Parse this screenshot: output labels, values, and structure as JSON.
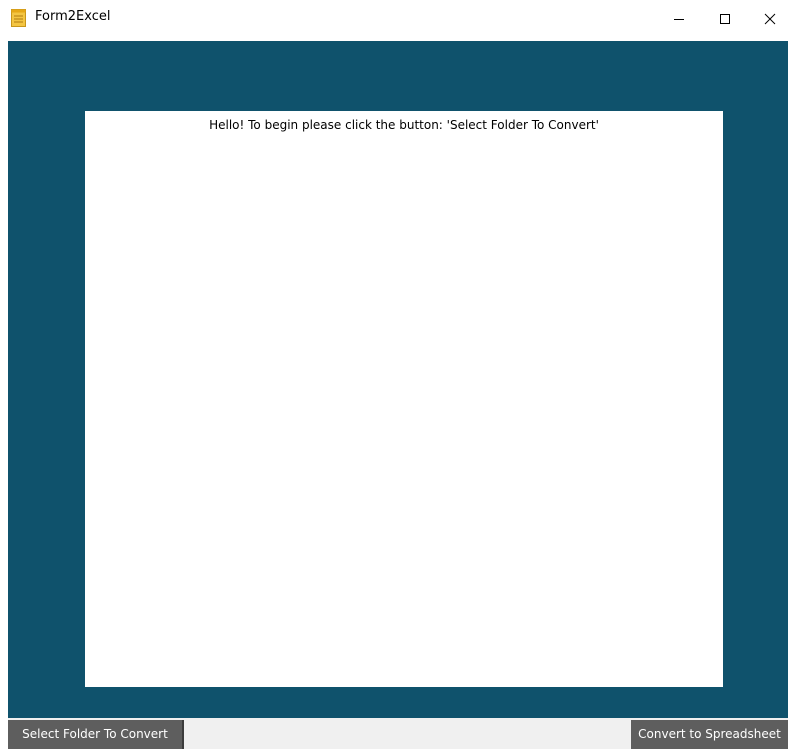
{
  "window": {
    "title": "Form2Excel",
    "icon": "notepad-icon"
  },
  "controls": {
    "minimize_icon": "minimize-icon",
    "maximize_icon": "maximize-icon",
    "close_icon": "close-icon"
  },
  "panel": {
    "message": "Hello! To begin please click the button: 'Select Folder To Convert'"
  },
  "buttons": {
    "select_folder": "Select Folder To Convert",
    "convert": "Convert to Spreadsheet"
  },
  "colors": {
    "background": "#0f526c",
    "button": "#5e5e5e",
    "button_text": "#ffffff"
  }
}
